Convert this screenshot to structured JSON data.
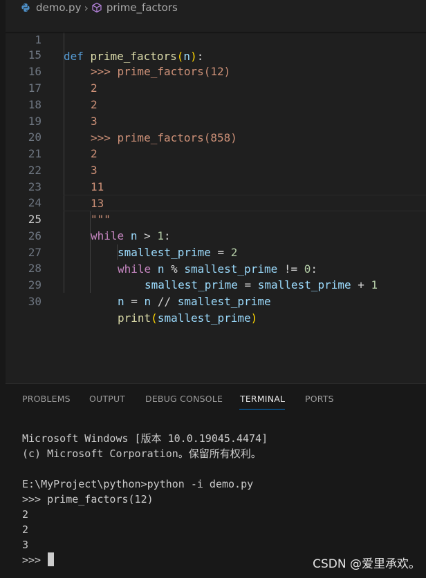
{
  "breadcrumb": {
    "file": "demo.py",
    "symbol": "prime_factors"
  },
  "editor": {
    "sticky": {
      "line": "1",
      "t0": "def",
      "t1": " ",
      "t2": "prime_factors",
      "t3": "(",
      "t4": "n",
      "t5": ")",
      "t6": ":"
    },
    "lines": [
      {
        "n": "15",
        "t0": ">>> prime_factors(12)"
      },
      {
        "n": "16",
        "t0": "2"
      },
      {
        "n": "17",
        "t0": "2"
      },
      {
        "n": "18",
        "t0": "3"
      },
      {
        "n": "19",
        "t0": ">>> prime_factors(858)"
      },
      {
        "n": "20",
        "t0": "2"
      },
      {
        "n": "21",
        "t0": "3"
      },
      {
        "n": "22",
        "t0": "11"
      },
      {
        "n": "23",
        "t0": "13"
      },
      {
        "n": "24",
        "t0": "\"\"\""
      },
      {
        "n": "25",
        "t0": "while",
        "t1": " ",
        "t2": "n",
        "t3": " > ",
        "t4": "1",
        "t5": ":"
      },
      {
        "n": "26",
        "t0": "smallest_prime",
        "t1": " = ",
        "t2": "2"
      },
      {
        "n": "27",
        "t0": "while",
        "t1": " ",
        "t2": "n",
        "t3": " % ",
        "t4": "smallest_prime",
        "t5": " != ",
        "t6": "0",
        "t7": ":"
      },
      {
        "n": "28",
        "t0": "smallest_prime",
        "t1": " = ",
        "t2": "smallest_prime",
        "t3": " + ",
        "t4": "1"
      },
      {
        "n": "29",
        "t0": "n",
        "t1": " = ",
        "t2": "n",
        "t3": " // ",
        "t4": "smallest_prime"
      },
      {
        "n": "30",
        "t0": "print",
        "t1": "(",
        "t2": "smallest_prime",
        "t3": ")"
      }
    ]
  },
  "panel": {
    "tabs": [
      "PROBLEMS",
      "OUTPUT",
      "DEBUG CONSOLE",
      "TERMINAL",
      "PORTS"
    ],
    "terminal_lines": [
      "Microsoft Windows [版本 10.0.19045.4474]",
      "(c) Microsoft Corporation。保留所有权利。",
      "E:\\MyProject\\python>python -i demo.py",
      ">>> prime_factors(12)",
      "2",
      "2",
      "3",
      ">>> "
    ]
  },
  "watermark": "CSDN @爱里承欢。",
  "colors": {
    "background": "#1f1f1f",
    "panel": "#181818",
    "keyword": "#569cd6",
    "control": "#c586c0",
    "function": "#dcdcaa",
    "variable": "#9cdcfe",
    "number": "#b5cea8",
    "string": "#ce9178",
    "tab_active_border": "#0078d4"
  },
  "icons": [
    "python-file-icon",
    "chevron-right-icon",
    "symbol-method-icon"
  ]
}
